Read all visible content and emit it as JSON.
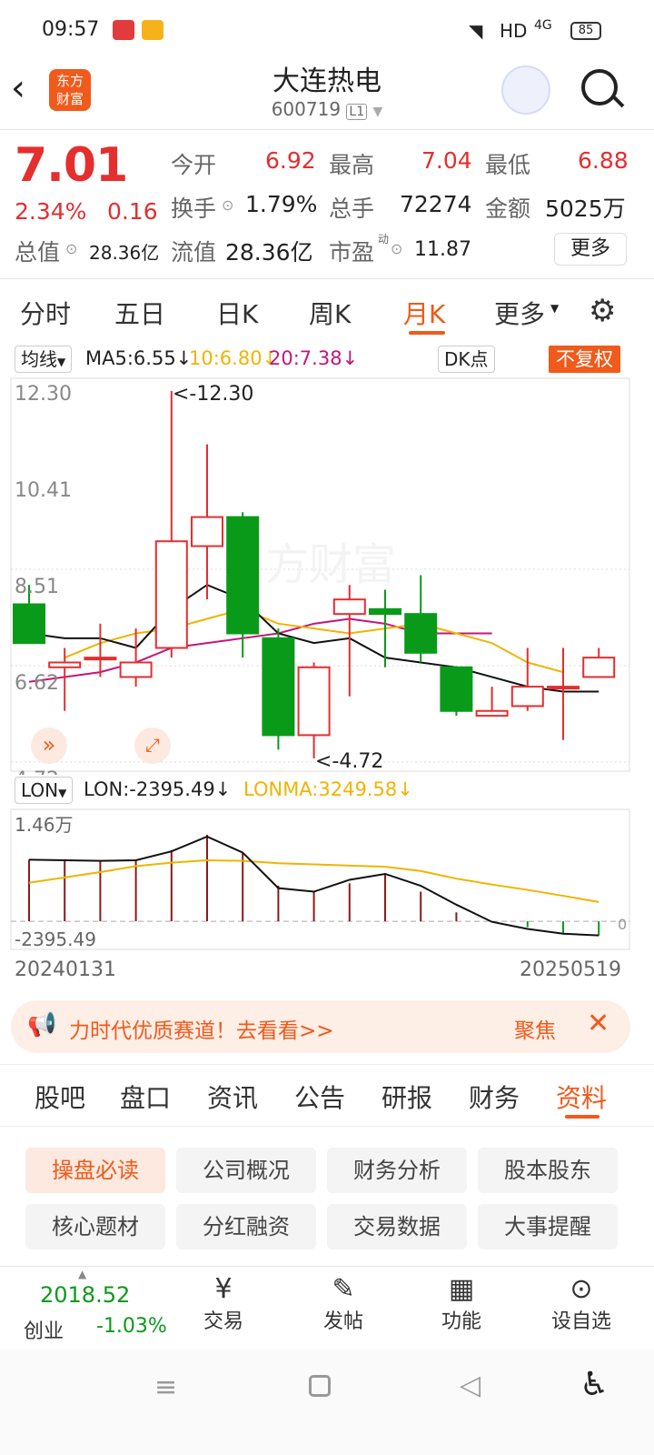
{
  "status_bar": {
    "time": "09:57",
    "network": "HD",
    "signal": "4G",
    "battery": "85"
  },
  "header": {
    "title": "大连热电",
    "code": "600719",
    "level": "L1",
    "logo_line1": "东方",
    "logo_line2": "财富"
  },
  "quote": {
    "price": "7.01",
    "change_pct": "2.34%",
    "change": "0.16",
    "open_label": "今开",
    "open": "6.92",
    "high_label": "最高",
    "high": "7.04",
    "low_label": "最低",
    "low": "6.88",
    "turnover_label": "换手",
    "turnover": "1.79%",
    "volume_label": "总手",
    "volume": "72274",
    "amount_label": "金额",
    "amount": "5025万",
    "mcap_label": "总值",
    "mcap": "28.36亿",
    "float_label": "流值",
    "float_value": "28.36亿",
    "pe_label": "市盈",
    "pe_sup": "动",
    "pe": "11.87",
    "more_button": "更多"
  },
  "period_tabs": [
    "分时",
    "五日",
    "日K",
    "周K",
    "月K",
    "更多"
  ],
  "active_period": "月K",
  "chart_bar": {
    "ma_selector": "均线",
    "ma5": "MA5:6.55↓",
    "ma10": "10:6.80↓",
    "ma20": "20:7.38↓",
    "dk_button": "DK点",
    "fq_button": "不复权"
  },
  "axis": {
    "y": [
      "12.30",
      "10.41",
      "8.51",
      "6.62",
      "4.72"
    ],
    "high_note": "<-12.30",
    "low_note": "<-4.72"
  },
  "indicator": {
    "selector": "LON",
    "lon": "LON:-2395.49↓",
    "lonma": "LONMA:3249.58↓",
    "top_label": "1.46万",
    "bottom_label": "-2395.49",
    "zero": "0",
    "date_start": "20240131",
    "date_end": "20250519"
  },
  "banner": {
    "text": "力时代优质赛道！去看看>>",
    "right": "聚焦"
  },
  "info_tabs": [
    "股吧",
    "盘口",
    "资讯",
    "公告",
    "研报",
    "财务",
    "资料"
  ],
  "active_info_tab": "资料",
  "pills": [
    "操盘必读",
    "公司概况",
    "财务分析",
    "股本股东",
    "核心题材",
    "分红融资",
    "交易数据",
    "大事提醒"
  ],
  "bottom_nav": {
    "index_value": "2018.52",
    "index_name": "创业",
    "index_change": "-1.03%",
    "trade": "交易",
    "post": "发帖",
    "func": "功能",
    "watch": "设自选"
  },
  "colors": {
    "up": "#e52e2e",
    "down": "#0a9a1a",
    "accent": "#f05a1a",
    "ma5": "#111111",
    "ma10": "#f0b400",
    "ma20": "#c4157a"
  },
  "chart_data": {
    "type": "candlestick",
    "note": "monthly K line",
    "ylim": [
      4.72,
      12.3
    ],
    "candles": [
      {
        "o": 7.9,
        "c": 7.1,
        "h": 8.3,
        "l": 7.1
      },
      {
        "o": 6.6,
        "c": 6.7,
        "h": 7.0,
        "l": 5.7
      },
      {
        "o": 6.8,
        "c": 6.8,
        "h": 7.5,
        "l": 6.4
      },
      {
        "o": 6.4,
        "c": 6.7,
        "h": 7.4,
        "l": 6.2
      },
      {
        "o": 7.0,
        "c": 9.2,
        "h": 12.3,
        "l": 6.8
      },
      {
        "o": 9.1,
        "c": 9.7,
        "h": 11.2,
        "l": 8.0
      },
      {
        "o": 9.7,
        "c": 7.3,
        "h": 9.8,
        "l": 6.8
      },
      {
        "o": 7.2,
        "c": 5.2,
        "h": 7.4,
        "l": 4.9
      },
      {
        "o": 5.2,
        "c": 6.6,
        "h": 6.7,
        "l": 4.72
      },
      {
        "o": 7.7,
        "c": 8.0,
        "h": 8.3,
        "l": 6.0
      },
      {
        "o": 7.8,
        "c": 7.7,
        "h": 8.2,
        "l": 6.6
      },
      {
        "o": 7.7,
        "c": 6.9,
        "h": 8.5,
        "l": 6.7
      },
      {
        "o": 6.6,
        "c": 5.7,
        "h": 6.6,
        "l": 5.6
      },
      {
        "o": 5.6,
        "c": 5.7,
        "h": 6.2,
        "l": 5.6
      },
      {
        "o": 5.8,
        "c": 6.2,
        "h": 7.0,
        "l": 5.7
      },
      {
        "o": 6.2,
        "c": 6.2,
        "h": 7.0,
        "l": 5.1
      },
      {
        "o": 6.4,
        "c": 6.8,
        "h": 7.0,
        "l": 6.4
      }
    ],
    "ma5": [
      7.3,
      7.2,
      7.2,
      7.0,
      7.8,
      8.3,
      8.0,
      7.3,
      7.1,
      7.2,
      6.8,
      6.7,
      6.6,
      6.4,
      6.2,
      6.1,
      6.1
    ],
    "ma10": [
      6.8,
      7.1,
      7.3,
      7.4,
      7.6,
      7.8,
      7.5,
      7.4,
      7.3,
      7.4,
      7.5,
      7.3,
      7.1,
      6.7,
      6.5
    ],
    "ma20": [
      6.3,
      6.4,
      6.5,
      6.7,
      7.0,
      7.1,
      7.2,
      7.3,
      7.5,
      7.6,
      7.5,
      7.3,
      7.3,
      7.3
    ],
    "lon_bars": [
      10400,
      10400,
      10200,
      10200,
      12000,
      14600,
      11600,
      6000,
      5000,
      6400,
      8000,
      5000,
      1500,
      -100,
      -1000,
      -2000,
      -2400
    ],
    "lon_line": [
      10400,
      10300,
      10200,
      10300,
      11800,
      14300,
      11600,
      5600,
      5000,
      7000,
      8000,
      6000,
      2800,
      -100,
      -1300,
      -2100,
      -2395
    ],
    "lonma_line": [
      6500,
      7400,
      8300,
      9300,
      9900,
      10300,
      10200,
      9800,
      9600,
      9400,
      9200,
      8500,
      7200,
      6200,
      5300,
      4300,
      3250
    ]
  }
}
